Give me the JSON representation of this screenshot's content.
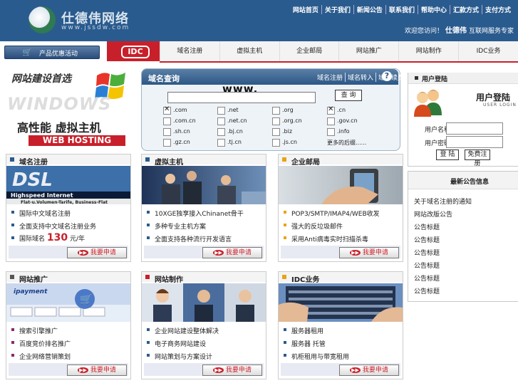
{
  "header": {
    "logo_text": "仕德伟网络",
    "logo_url": "www.jssdw.com",
    "top_links": [
      "网站首页",
      "关于我们",
      "新闻公告",
      "联系我们",
      "帮助中心",
      "汇款方式",
      "支付方式"
    ],
    "slogan_pre": "欢迎您访问！",
    "slogan_brand": "仕德伟",
    "slogan_post": "互联网服务专家"
  },
  "nav": {
    "promo_label": "产品优惠活动",
    "idc_logo": "IDC",
    "items": [
      "域名注册",
      "虚拟主机",
      "企业邮局",
      "网站推广",
      "网站制作",
      "IDC业务"
    ]
  },
  "banner": {
    "line1": "网站建设首选",
    "line2": "WINDOWS",
    "line3": "高性能 虚拟主机",
    "line4": "WEB HOSTING"
  },
  "domain": {
    "title": "域名查询",
    "links": [
      "域名注册",
      "域名转入",
      "域名续费"
    ],
    "help_icon": "?",
    "www": "www.",
    "search_button": "查 询",
    "options": [
      {
        "label": ".com",
        "checked": true
      },
      {
        "label": ".net",
        "checked": false
      },
      {
        "label": ".org",
        "checked": false
      },
      {
        "label": ".cn",
        "checked": true
      },
      {
        "label": ".com.cn",
        "checked": false
      },
      {
        "label": ".net.cn",
        "checked": false
      },
      {
        "label": ".org.cn",
        "checked": false
      },
      {
        "label": ".gov.cn",
        "checked": false
      },
      {
        "label": ".sh.cn",
        "checked": false
      },
      {
        "label": ".bj.cn",
        "checked": false
      },
      {
        "label": ".biz",
        "checked": false
      },
      {
        "label": ".info",
        "checked": false
      },
      {
        "label": ".gz.cn",
        "checked": false
      },
      {
        "label": ".tj.cn",
        "checked": false
      },
      {
        "label": ".js.cn",
        "checked": false
      },
      {
        "label": "更多的后缀......",
        "checked": null
      }
    ]
  },
  "login": {
    "title": "用户登陆",
    "big_title": "用户登陆",
    "sub": "USER LOGIN",
    "name_label": "用户名称：",
    "pass_label": "用户密码：",
    "login_button": "登 陆",
    "register_button": "免费注册"
  },
  "notice": {
    "title": "最新公告信息",
    "items": [
      "关于域名注册的通知",
      "网站改版公告",
      "公告标题",
      "公告标题",
      "公告标题",
      "公告标题",
      "公告标题",
      "公告标题"
    ]
  },
  "cards": [
    {
      "title": "域名注册",
      "square": "#2a5b8e",
      "img": "DSL",
      "img_sub": "Highspeed Internet",
      "img_sub2": "Flat-u.Volumen-Tarife, Business-Flat",
      "items": [
        {
          "text": "国际中文域名注册"
        },
        {
          "text": "全面支持中文域名注册业务"
        },
        {
          "text": "国际域名",
          "price": "130",
          "unit": "元/年"
        }
      ],
      "apply": "我要申请"
    },
    {
      "title": "虚拟主机",
      "square": "#2a5b8e",
      "img": "meeting",
      "items": [
        {
          "text": "10XGE独享接入Chinanet骨干"
        },
        {
          "text": "多种专业主机方案"
        },
        {
          "text": "全面支持各种流行开发语言"
        }
      ],
      "apply": "我要申请"
    },
    {
      "title": "企业邮局",
      "square": "#e8a317",
      "img": "pda",
      "items": [
        {
          "text": "POP3/SMTP/IMAP4/WEB收发"
        },
        {
          "text": "强大的反垃圾邮件"
        },
        {
          "text": "采用Anti病毒实时扫描杀毒"
        }
      ],
      "apply": "我要申请"
    },
    {
      "title": "网站推广",
      "square": "#555",
      "img": "ipayment",
      "items": [
        {
          "text": "搜索引擎推广"
        },
        {
          "text": "百度竞价排名推广"
        },
        {
          "text": "企业网络营销策划"
        }
      ],
      "apply": "我要申请"
    },
    {
      "title": "网站制作",
      "square": "#c8202a",
      "img": "people",
      "items": [
        {
          "text": "企业网站建设整体解决"
        },
        {
          "text": "电子商务网站建设"
        },
        {
          "text": "网站策划与方案设计"
        }
      ],
      "apply": "我要申请"
    },
    {
      "title": "IDC业务",
      "square": "#e8a317",
      "img": "server",
      "items": [
        {
          "text": "服务器租用"
        },
        {
          "text": "服务器 托管"
        },
        {
          "text": "机柜租用与带宽租用"
        }
      ],
      "apply": "我要申请"
    }
  ]
}
